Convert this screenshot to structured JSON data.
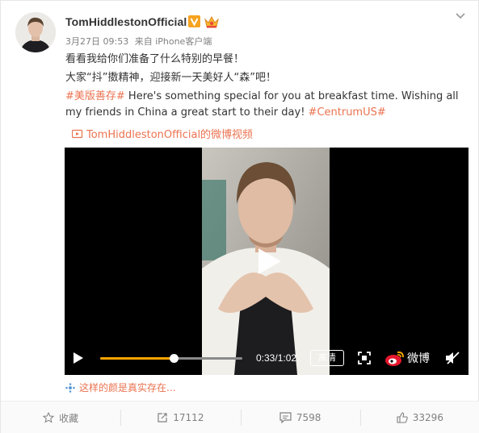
{
  "post": {
    "username": "TomHiddlestonOfficial",
    "date": "3月27日 09:53",
    "source": "来自 iPhone客户端",
    "line1": "看看我给你们准备了什么特别的早餐！",
    "line2": "大家“抖”擞精神，迎接新一天美好人“森”吧！",
    "hashtag": "#美版善存#",
    "english": " Here's something special for you at breakfast time. Wishing all my friends in China a great start to their day! ",
    "hashtag2": "#CentrumUS#",
    "video_link": "TomHiddlestonOfficial的微博视频"
  },
  "video": {
    "time": "0:33/1:02",
    "quality": "高清",
    "brand": "微博",
    "progress": 0.52
  },
  "related": "这样的颜是真实存在...",
  "actions": {
    "favorite": "收藏",
    "repost": "17112",
    "comment": "7598",
    "like": "33296"
  },
  "colors": {
    "accent": "#eb7350",
    "progress": "#ffa500",
    "verified": "#f6a320"
  },
  "icons": [
    "chevron-down-icon",
    "verified-badge-icon",
    "crown-icon",
    "video-link-icon",
    "play-icon",
    "fullscreen-icon",
    "weibo-logo-icon",
    "mute-icon",
    "topic-icon",
    "star-icon",
    "repost-icon",
    "comment-icon",
    "like-icon"
  ]
}
